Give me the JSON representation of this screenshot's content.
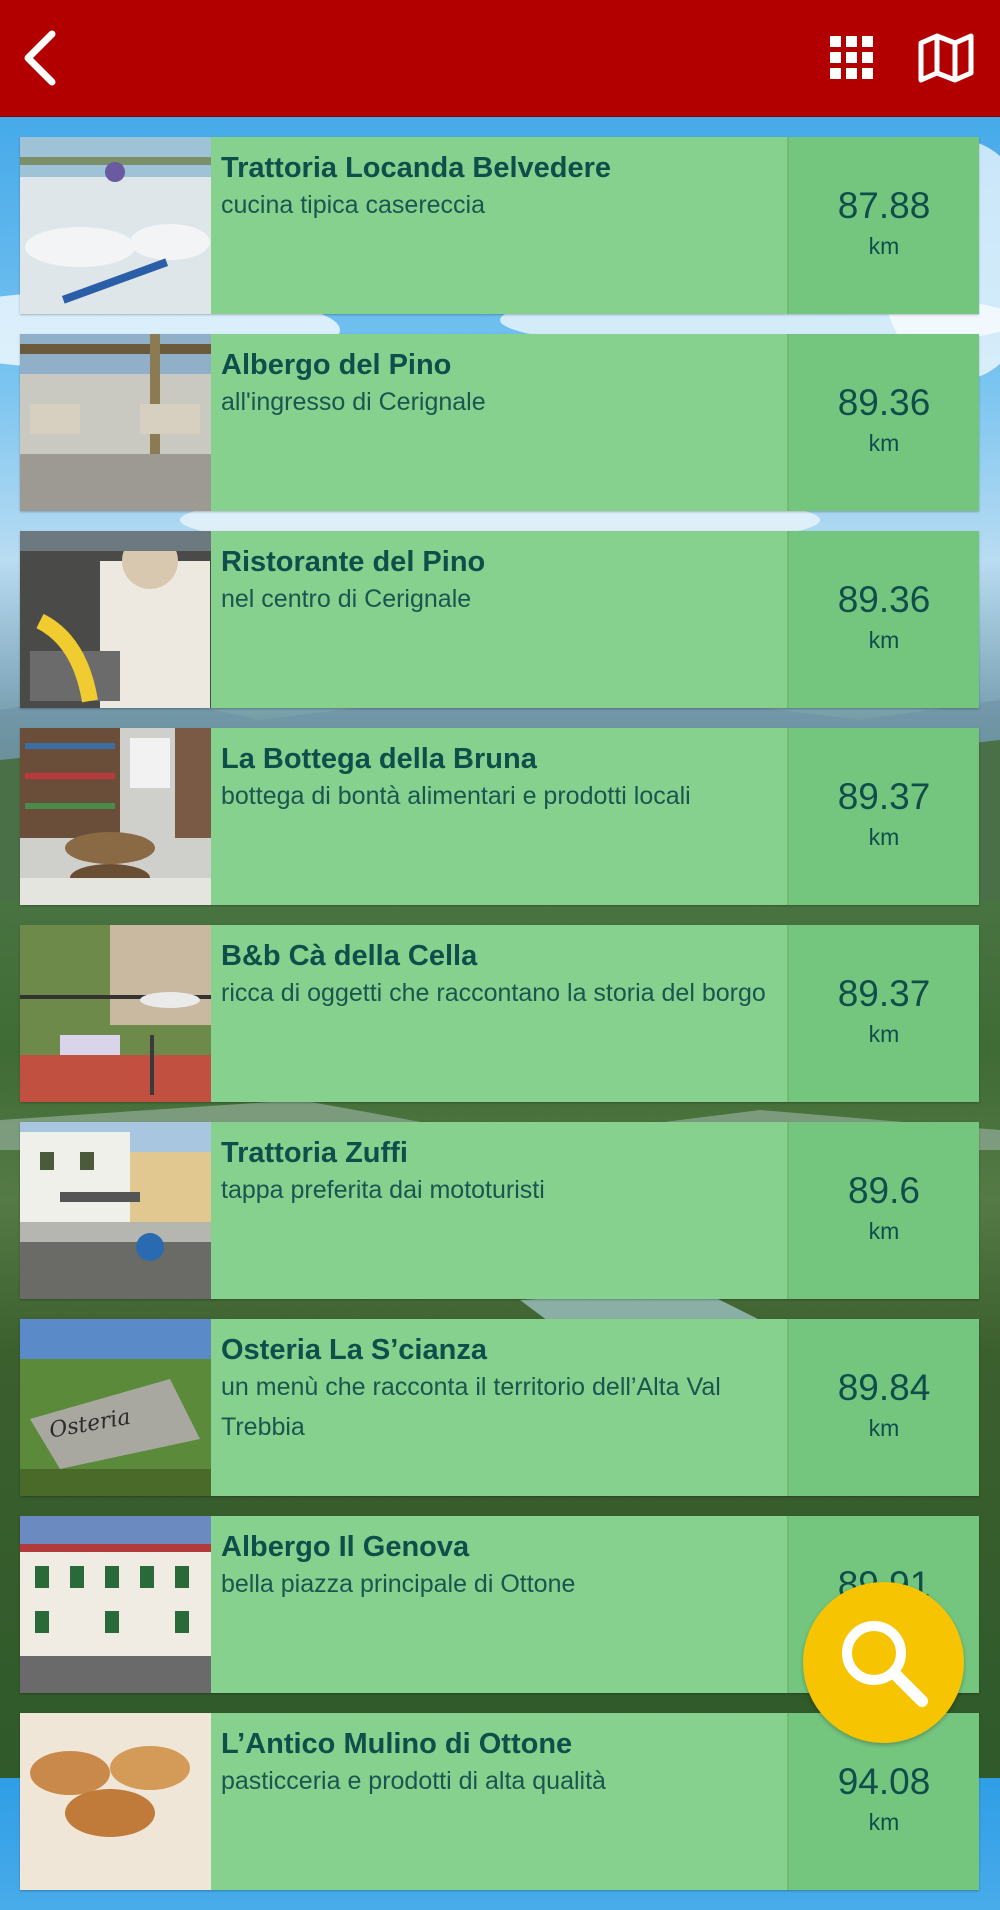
{
  "header": {
    "back_icon": "chevron-left-icon",
    "grid_icon": "grid-menu-icon",
    "map_icon": "map-icon",
    "accent": "#b20000"
  },
  "items": [
    {
      "name": "Trattoria Locanda Belvedere",
      "desc": "cucina tipica casereccia",
      "distance": "87.88",
      "unit": "km",
      "photo": "table-setting"
    },
    {
      "name": "Albergo del Pino",
      "desc": "all'ingresso di Cerignale",
      "distance": "89.36",
      "unit": "km",
      "photo": "pergola-terrace"
    },
    {
      "name": "Ristorante del Pino",
      "desc": "nel centro di Cerignale",
      "distance": "89.36",
      "unit": "km",
      "photo": "pasta-making"
    },
    {
      "name": "La Bottega della Bruna",
      "desc": "bottega di bontà alimentari e prodotti locali",
      "distance": "89.37",
      "unit": "km",
      "photo": "shop-interior"
    },
    {
      "name": "B&b Cà della Cella",
      "desc": "ricca di oggetti che raccontano la storia del borgo",
      "distance": "89.37",
      "unit": "km",
      "photo": "balcony"
    },
    {
      "name": "Trattoria Zuffi",
      "desc": "tappa preferita dai mototuristi",
      "distance": "89.6",
      "unit": "km",
      "photo": "street-terrace"
    },
    {
      "name": "Osteria La S’cianza",
      "desc": "un menù che racconta il territorio dell’Alta Val Trebbia",
      "distance": "89.84",
      "unit": "km",
      "photo": "stone-sign"
    },
    {
      "name": "Albergo Il Genova",
      "desc": "bella piazza principale di Ottone",
      "distance": "89.91",
      "unit": "km",
      "photo": "hotel-facade"
    },
    {
      "name": "L’Antico Mulino di Ottone",
      "desc": "pasticceria e prodotti di alta qualità",
      "distance": "94.08",
      "unit": "km",
      "photo": "pastries"
    }
  ],
  "fab": {
    "icon": "search-icon",
    "color": "#f6c400"
  }
}
